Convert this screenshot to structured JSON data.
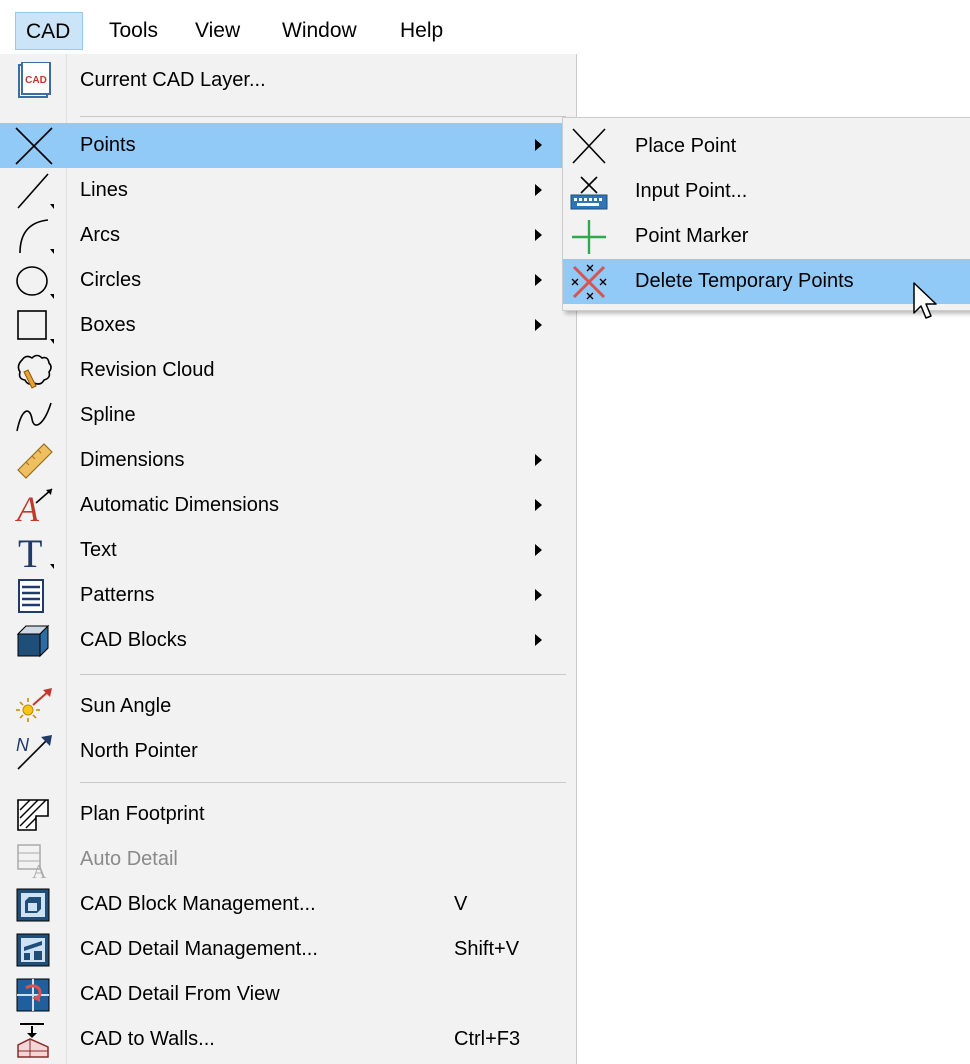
{
  "menubar": {
    "items": [
      {
        "label": "CAD",
        "active": true
      },
      {
        "label": "Tools",
        "active": false
      },
      {
        "label": "View",
        "active": false
      },
      {
        "label": "Window",
        "active": false
      },
      {
        "label": "Help",
        "active": false
      }
    ]
  },
  "cad_menu": {
    "items": [
      {
        "label": "Current CAD Layer...",
        "icon": "cad-layer-icon"
      },
      {
        "label": "Points",
        "icon": "point-x-icon",
        "submenu": true,
        "highlighted": true
      },
      {
        "label": "Lines",
        "icon": "line-icon",
        "submenu": true
      },
      {
        "label": "Arcs",
        "icon": "arc-icon",
        "submenu": true
      },
      {
        "label": "Circles",
        "icon": "circle-icon",
        "submenu": true
      },
      {
        "label": "Boxes",
        "icon": "box-icon",
        "submenu": true
      },
      {
        "label": "Revision Cloud",
        "icon": "revision-cloud-icon"
      },
      {
        "label": "Spline",
        "icon": "spline-icon"
      },
      {
        "label": "Dimensions",
        "icon": "ruler-icon",
        "submenu": true
      },
      {
        "label": "Automatic Dimensions",
        "icon": "auto-dimension-icon",
        "submenu": true
      },
      {
        "label": "Text",
        "icon": "text-icon",
        "submenu": true
      },
      {
        "label": "Patterns",
        "icon": "patterns-icon",
        "submenu": true
      },
      {
        "label": "CAD Blocks",
        "icon": "cad-block-icon",
        "submenu": true
      },
      {
        "label": "Sun Angle",
        "icon": "sun-angle-icon"
      },
      {
        "label": "North Pointer",
        "icon": "north-pointer-icon"
      },
      {
        "label": "Plan Footprint",
        "icon": "plan-footprint-icon"
      },
      {
        "label": "Auto Detail",
        "icon": "auto-detail-icon",
        "disabled": true
      },
      {
        "label": "CAD Block Management...",
        "icon": "block-management-icon",
        "shortcut": "V"
      },
      {
        "label": "CAD Detail Management...",
        "icon": "detail-management-icon",
        "shortcut": "Shift+V"
      },
      {
        "label": "CAD Detail From View",
        "icon": "detail-from-view-icon"
      },
      {
        "label": "CAD to Walls...",
        "icon": "cad-to-walls-icon",
        "shortcut": "Ctrl+F3"
      }
    ]
  },
  "points_submenu": {
    "items": [
      {
        "label": "Place Point",
        "icon": "place-point-icon"
      },
      {
        "label": "Input Point...",
        "icon": "input-point-icon"
      },
      {
        "label": "Point Marker",
        "icon": "point-marker-icon"
      },
      {
        "label": "Delete Temporary Points",
        "icon": "delete-points-icon",
        "highlighted": true
      }
    ]
  },
  "colors": {
    "highlight": "#91c9f7",
    "menu_bg": "#f2f2f2",
    "active_top": "#cce4f7"
  }
}
